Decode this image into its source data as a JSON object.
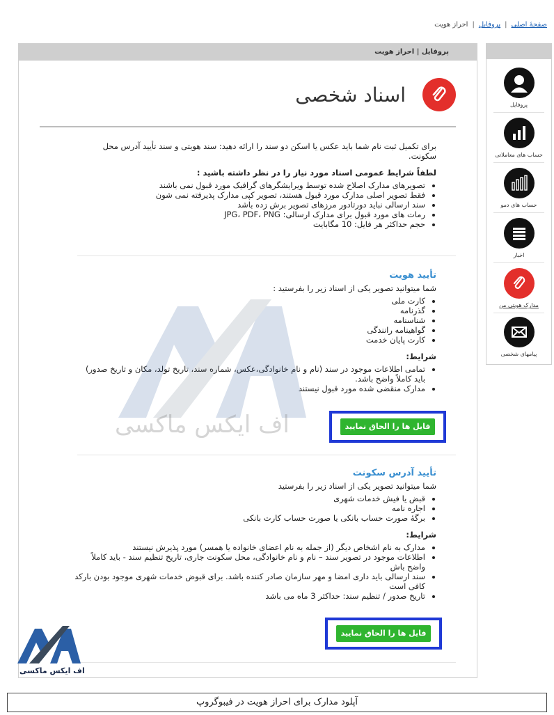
{
  "breadcrumb": {
    "home": "صفحهٔ اصلی",
    "profile": "پروفایل",
    "current": "احراز هویت",
    "sep": "|"
  },
  "sidebar": {
    "items": [
      {
        "label": "پروفایل",
        "icon": "user-icon"
      },
      {
        "label": "حساب های معاملاتی",
        "icon": "bar-chart-icon"
      },
      {
        "label": "حساب های دمو",
        "icon": "demo-chart-icon"
      },
      {
        "label": "اخبار",
        "icon": "news-icon"
      },
      {
        "label": "مدارک هویتی من",
        "icon": "paperclip-icon"
      },
      {
        "label": "پیامهای شخصی",
        "icon": "mail-icon"
      }
    ]
  },
  "panel": {
    "header": "پروفایل | احراز هویت",
    "title": "اسناد شخصی",
    "intro": "برای تکمیل ثبت نام شما باید عکس یا اسکن دو سند را ارائه دهید: سند هویتی و سند تأیید آدرس محل سکونت.",
    "general_heading": "لطفاً شرایط عمومی اسناد مورد نیاز را در نظر داشته باشید :",
    "general_items": [
      "تصویرهای مدارک اصلاح شده توسط ویرایشگرهای گرافیک مورد قبول نمی باشند",
      "فقط تصویر اصلی مدارک مورد قبول هستند، تصویر کپی مدارک پذیرفته نمی شون",
      "سند ارسالی نباید دورتادور مرزهای تصویر برش زده باشد",
      "رمات های مورد قبول برای مدارک ارسالی: JPG، PDF، PNG",
      "حجم حداکثر هر فایل: 10 مگابایت"
    ],
    "identity": {
      "title": "تأیید هویت",
      "lead": "شما میتوانید تصویر یکی از اسناد زیر را بفرستید :",
      "docs": [
        "کارت ملی",
        "گذرنامه",
        "شناسنامه",
        "گواهینامه رانندگی",
        "کارت پایان خدمت"
      ],
      "cond_heading": "شرایط:",
      "conditions": [
        "تمامی اطلاعات موجود در سند (نام و نام خانوادگی،عکس، شماره سند، تاریخ تولد، مکان و تاریخ صدور) باید کاملاً واضح باشد.",
        "مدارک منقضی شده مورد قبول نیستند"
      ],
      "button": "فایل ها را الحاق نمایید"
    },
    "address": {
      "title": "تأیید آدرس سکونت",
      "lead": "شما میتوانید تصویر یکی از اسناد زیر را بفرستید",
      "docs": [
        "قبض یا فیش خدمات شهری",
        "اجاره نامه",
        "برگهٔ صورت حساب بانکی یا صورت حساب کارت بانکی"
      ],
      "cond_heading": "شرایط:",
      "conditions": [
        "مدارک به نام اشخاص دیگر (از جمله به نام اعضای خانواده یا همسر) مورد پذیرش نیستند",
        "اطلاعات موجود در تصویر سند – نام و نام خانوادگی، محل سکونت جاری، تاریخ تنظیم سند - باید کاملاً واضح باش",
        "سند ارسالی باید داری امضا و مهر سازمان صادر کننده باشد. برای قبوض خدمات شهری موجود بودن بارکد کافی است",
        "تاریخ صدور / تنظیم سند: حداکثر 3 ماه می باشد"
      ],
      "button": "فایل ها را الحاق نمایید"
    }
  },
  "watermark": {
    "text": "اف ایکس ماکسی"
  },
  "corner_logo": {
    "text": "اف ایکس ماکسی"
  },
  "caption": "آپلود مدارک برای احراز هویت در فیبوگروپ",
  "colors": {
    "accent_red": "#e32f2b",
    "link_blue": "#3a8fd0",
    "button_green": "#2fb52f",
    "highlight_border": "#1f39d6"
  }
}
